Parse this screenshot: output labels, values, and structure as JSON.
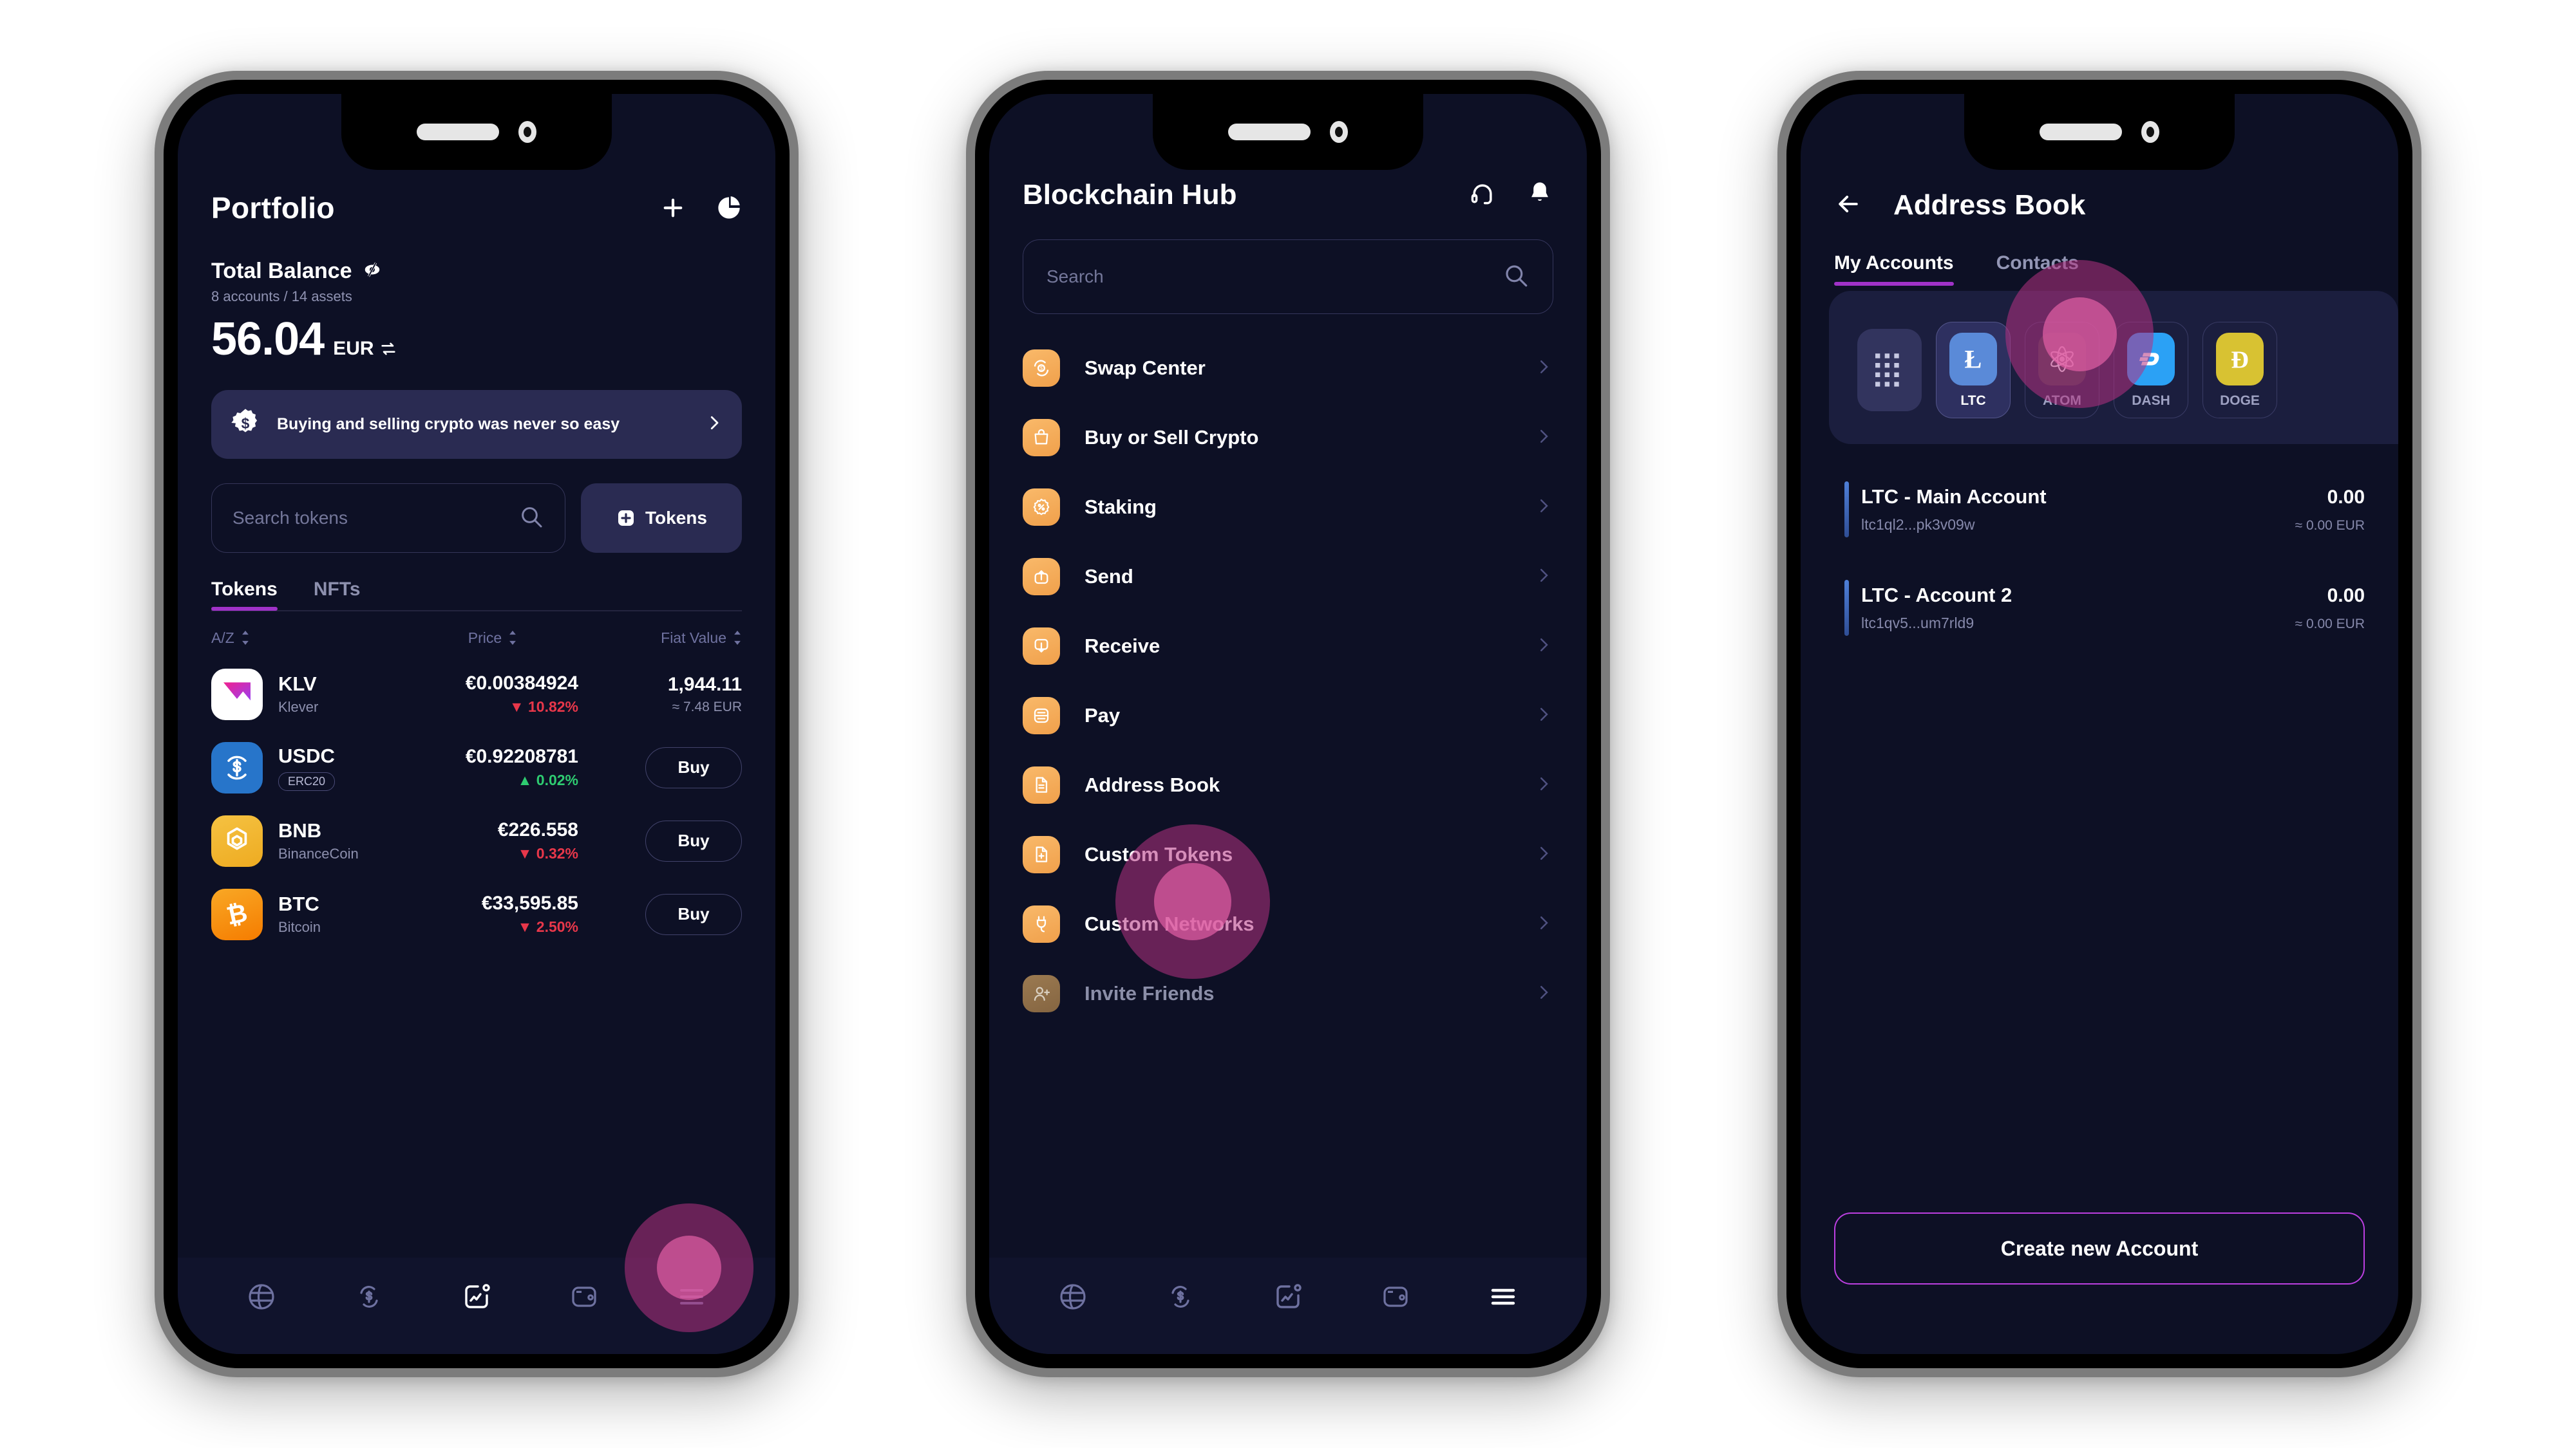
{
  "phone1": {
    "header": {
      "title": "Portfolio",
      "add_icon": "plus-icon",
      "chart_icon": "pie-chart-icon"
    },
    "balance": {
      "label": "Total Balance",
      "hide_icon": "eye-hidden-icon",
      "sub": "8 accounts / 14 assets",
      "amount": "56.04",
      "currency": "EUR",
      "swap_icon": "currency-swap-icon"
    },
    "promo": {
      "icon": "dollar-badge-icon",
      "text": "Buying and selling crypto was never so easy",
      "chevron": "chevron-right-icon"
    },
    "search": {
      "placeholder": "Search tokens",
      "icon": "search-icon"
    },
    "tokens_button": {
      "label": "Tokens",
      "icon": "plus-square-icon"
    },
    "tabs": [
      {
        "label": "Tokens",
        "active": true
      },
      {
        "label": "NFTs",
        "active": false
      }
    ],
    "sort_headers": {
      "name": "A/Z",
      "price": "Price",
      "fiat": "Fiat Value"
    },
    "tokens": [
      {
        "symbol": "KLV",
        "name": "Klever",
        "badge": "",
        "price": "€0.00384924",
        "delta": "10.82%",
        "dir": "down",
        "value": "1,944.11",
        "value_eur": "≈ 7.48 EUR",
        "action": ""
      },
      {
        "symbol": "USDC",
        "name": "",
        "badge": "ERC20",
        "price": "€0.92208781",
        "delta": "0.02%",
        "dir": "up",
        "value": "",
        "value_eur": "",
        "action": "Buy"
      },
      {
        "symbol": "BNB",
        "name": "BinanceCoin",
        "badge": "",
        "price": "€226.558",
        "delta": "0.32%",
        "dir": "down",
        "value": "",
        "value_eur": "",
        "action": "Buy"
      },
      {
        "symbol": "BTC",
        "name": "Bitcoin",
        "badge": "",
        "price": "€33,595.85",
        "delta": "2.50%",
        "dir": "down",
        "value": "",
        "value_eur": "",
        "action": "Buy"
      }
    ],
    "bottom_nav": [
      {
        "icon": "globe-icon",
        "active": false
      },
      {
        "icon": "swap-dollar-icon",
        "active": false
      },
      {
        "icon": "activity-chart-icon",
        "active": true
      },
      {
        "icon": "wallet-icon",
        "active": false
      },
      {
        "icon": "hamburger-menu-icon",
        "active": false
      }
    ]
  },
  "phone2": {
    "header": {
      "title": "Blockchain Hub",
      "support_icon": "headset-icon",
      "bell_icon": "bell-icon"
    },
    "search": {
      "placeholder": "Search",
      "icon": "search-icon"
    },
    "menu": [
      {
        "label": "Swap Center",
        "icon": "swap-center-icon",
        "dim": false
      },
      {
        "label": "Buy or Sell Crypto",
        "icon": "shopping-bag-icon",
        "dim": false
      },
      {
        "label": "Staking",
        "icon": "percent-badge-icon",
        "dim": false
      },
      {
        "label": "Send",
        "icon": "send-up-icon",
        "dim": false
      },
      {
        "label": "Receive",
        "icon": "receive-down-icon",
        "dim": false
      },
      {
        "label": "Pay",
        "icon": "pay-scan-icon",
        "dim": false
      },
      {
        "label": "Address Book",
        "icon": "document-icon",
        "dim": false
      },
      {
        "label": "Custom Tokens",
        "icon": "document-plus-icon",
        "dim": false
      },
      {
        "label": "Custom Networks",
        "icon": "plug-icon",
        "dim": false
      },
      {
        "label": "Invite Friends",
        "icon": "user-plus-icon",
        "dim": true
      }
    ],
    "bottom_nav": [
      {
        "icon": "globe-icon",
        "active": false
      },
      {
        "icon": "swap-dollar-icon",
        "active": false
      },
      {
        "icon": "activity-chart-icon",
        "active": false
      },
      {
        "icon": "wallet-icon",
        "active": false
      },
      {
        "icon": "hamburger-menu-icon",
        "active": true
      }
    ]
  },
  "phone3": {
    "header": {
      "back_icon": "arrow-left-icon",
      "title": "Address Book"
    },
    "tabs": [
      {
        "label": "My Accounts",
        "active": true
      },
      {
        "label": "Contacts",
        "active": false
      }
    ],
    "chips": [
      {
        "label": "",
        "symbol": "grid",
        "color": "#32345e",
        "active": false
      },
      {
        "label": "LTC",
        "symbol": "Ł",
        "color": "#5a8ad8",
        "active": true
      },
      {
        "label": "ATOM",
        "symbol": "atom",
        "color": "#3a3b45",
        "active": false
      },
      {
        "label": "DASH",
        "symbol": "D",
        "color": "#2ba1f5",
        "active": false
      },
      {
        "label": "DOGE",
        "symbol": "Ð",
        "color": "#d8c232",
        "active": false
      }
    ],
    "accounts": [
      {
        "name": "LTC - Main Account",
        "address": "ltc1ql2...pk3v09w",
        "balance": "0.00",
        "fiat": "≈ 0.00 EUR"
      },
      {
        "name": "LTC - Account 2",
        "address": "ltc1qv5...um7rld9",
        "balance": "0.00",
        "fiat": "≈ 0.00 EUR"
      }
    ],
    "create_button": "Create new Account"
  },
  "theme": {
    "accent": "#a032c8",
    "screen_bg": "#0d1025",
    "card_bg": "#1b1e3e",
    "promo_bg": "#2a2b52",
    "down": "#e8374a",
    "up": "#2ecc71",
    "orange": "#f0a04b"
  }
}
